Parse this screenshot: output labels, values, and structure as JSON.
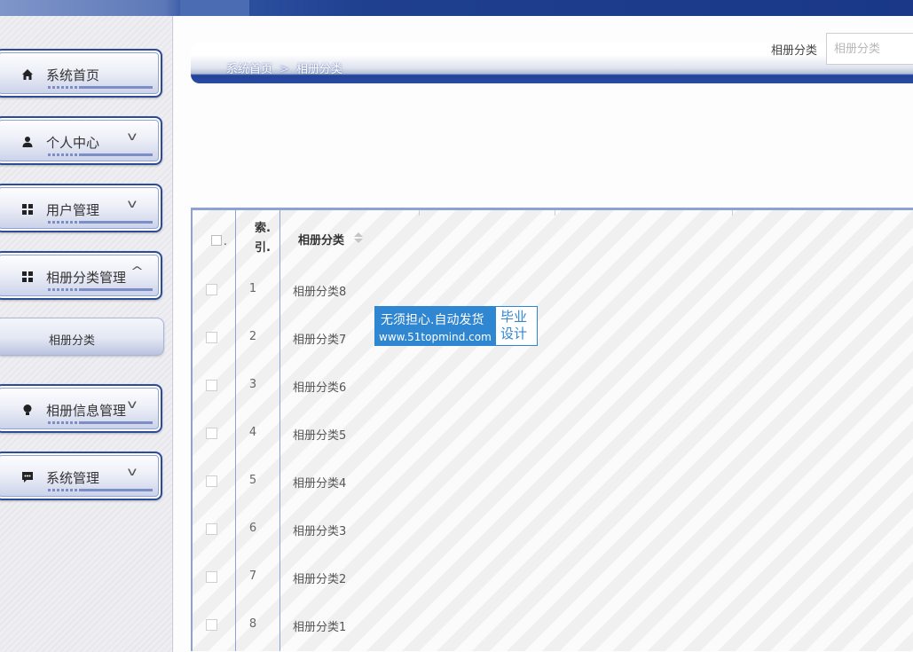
{
  "sidebar": {
    "items": [
      {
        "label": "系统首页",
        "icon": "home-icon",
        "chevron": ""
      },
      {
        "label": "个人中心",
        "icon": "user-icon",
        "chevron": "v"
      },
      {
        "label": "用户管理",
        "icon": "grid-icon",
        "chevron": "v"
      },
      {
        "label": "相册分类管理",
        "icon": "grid-icon",
        "chevron": "^"
      },
      {
        "label": "相册信息管理",
        "icon": "bulb-icon",
        "chevron": "v"
      },
      {
        "label": "系统管理",
        "icon": "chat-icon",
        "chevron": "v"
      }
    ],
    "submenu": {
      "label": "相册分类"
    }
  },
  "breadcrumb": {
    "home": "系统首页",
    "separator": ">",
    "current": "相册分类"
  },
  "search": {
    "label": "相册分类",
    "placeholder": "相册分类",
    "value": ""
  },
  "table": {
    "index_header": "索.\n引.",
    "checkbox_header": ".",
    "column_header": "相册分类",
    "rows": [
      {
        "index": "1",
        "name": "相册分类8"
      },
      {
        "index": "2",
        "name": "相册分类7"
      },
      {
        "index": "3",
        "name": "相册分类6"
      },
      {
        "index": "4",
        "name": "相册分类5"
      },
      {
        "index": "5",
        "name": "相册分类4"
      },
      {
        "index": "6",
        "name": "相册分类3"
      },
      {
        "index": "7",
        "name": "相册分类2"
      },
      {
        "index": "8",
        "name": "相册分类1"
      }
    ]
  },
  "watermark": {
    "line1": "无须担心.自动发货",
    "line2": "www.51topmind.com",
    "side": "毕业设计"
  },
  "colors": {
    "accent": "#2a4aa0",
    "border": "#8da2d3",
    "badge": "#2f86d1"
  }
}
